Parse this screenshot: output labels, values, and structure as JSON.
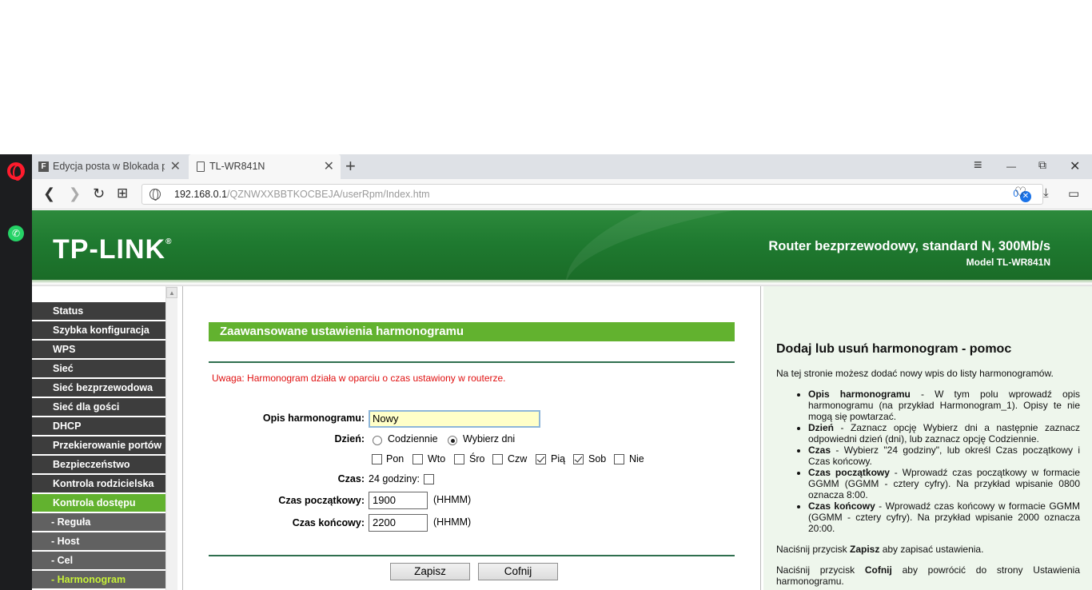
{
  "browser": {
    "tabs": [
      {
        "label": "Edycja posta w Blokada po",
        "favicon": "F"
      },
      {
        "label": "TL-WR841N"
      }
    ],
    "url_host": "192.168.0.1",
    "url_path": "/QZNWXXBBTKOCBEJA/userRpm/Index.htm",
    "blocker_count": "0",
    "icons": {
      "back": "❮",
      "forward": "❯",
      "reload": "↻",
      "speed_dial": "⊞",
      "close": "✕",
      "new_tab": "+",
      "menu": "≡",
      "minimize": "—",
      "restore": "⧉",
      "heart": "♡",
      "download": "⤓",
      "battery": "▭",
      "whatsapp": "✆"
    }
  },
  "router": {
    "logo": "TP-LINK",
    "logo_mark": "®",
    "title": "Router bezprzewodowy, standard N, 300Mb/s",
    "model": "Model TL-WR841N"
  },
  "menu": {
    "items": [
      {
        "label": "Status"
      },
      {
        "label": "Szybka konfiguracja"
      },
      {
        "label": "WPS"
      },
      {
        "label": "Sieć"
      },
      {
        "label": "Sieć bezprzewodowa"
      },
      {
        "label": "Sieć dla gości"
      },
      {
        "label": "DHCP"
      },
      {
        "label": "Przekierowanie portów"
      },
      {
        "label": "Bezpieczeństwo"
      },
      {
        "label": "Kontrola rodzicielska"
      },
      {
        "label": "Kontrola dostępu"
      },
      {
        "label": "- Reguła"
      },
      {
        "label": "- Host"
      },
      {
        "label": "- Cel"
      },
      {
        "label": "- Harmonogram"
      }
    ]
  },
  "main": {
    "title": "Zaawansowane ustawienia harmonogramu",
    "warning": "Uwaga: Harmonogram działa w oparciu o czas ustawiony w routerze.",
    "desc_label": "Opis harmonogramu:",
    "desc_value": "Nowy",
    "day_label": "Dzień:",
    "radio_daily": "Codziennie",
    "radio_select": "Wybierz dni",
    "days": [
      {
        "label": "Pon",
        "checked": false
      },
      {
        "label": "Wto",
        "checked": false
      },
      {
        "label": "Śro",
        "checked": false
      },
      {
        "label": "Czw",
        "checked": false
      },
      {
        "label": "Pią",
        "checked": true
      },
      {
        "label": "Sob",
        "checked": true
      },
      {
        "label": "Nie",
        "checked": false
      }
    ],
    "time_label": "Czas:",
    "all_day_label": "24 godziny:",
    "start_label": "Czas początkowy:",
    "start_value": "1900",
    "end_label": "Czas końcowy:",
    "end_value": "2200",
    "format_hint": "(HHMM)",
    "save_label": "Zapisz",
    "back_label": "Cofnij"
  },
  "help": {
    "title": "Dodaj lub usuń harmonogram - pomoc",
    "intro": "Na tej stronie możesz dodać nowy wpis do listy harmonogramów.",
    "items": [
      {
        "term": "Opis harmonogramu",
        "text": " - W tym polu wprowadź opis harmonogramu (na przykład Harmonogram_1). Opisy te nie mogą się powtarzać."
      },
      {
        "term": "Dzień",
        "text": " - Zaznacz opcję Wybierz dni a następnie zaznacz odpowiedni dzień (dni), lub zaznacz opcję Codziennie."
      },
      {
        "term": "Czas",
        "text": " - Wybierz \"24 godziny\", lub określ Czas początkowy i Czas końcowy."
      },
      {
        "term": "Czas początkowy",
        "text": " - Wprowadź czas początkowy w formacie GGMM (GGMM - cztery cyfry). Na przykład wpisanie 0800 oznacza 8:00."
      },
      {
        "term": "Czas końcowy",
        "text": " - Wprowadź czas końcowy w formacie GGMM (GGMM - cztery cyfry). Na przykład wpisanie 2000 oznacza 20:00."
      }
    ],
    "save_pre": "Naciśnij przycisk ",
    "save_term": "Zapisz",
    "save_post": " aby zapisać ustawienia.",
    "back_pre": "Naciśnij przycisk ",
    "back_term": "Cofnij",
    "back_post": " aby powrócić do strony Ustawienia harmonogramu."
  },
  "colors": {
    "accent_green": "#62b22f",
    "header_green": "#1f7a30",
    "warning_red": "#e01010"
  }
}
